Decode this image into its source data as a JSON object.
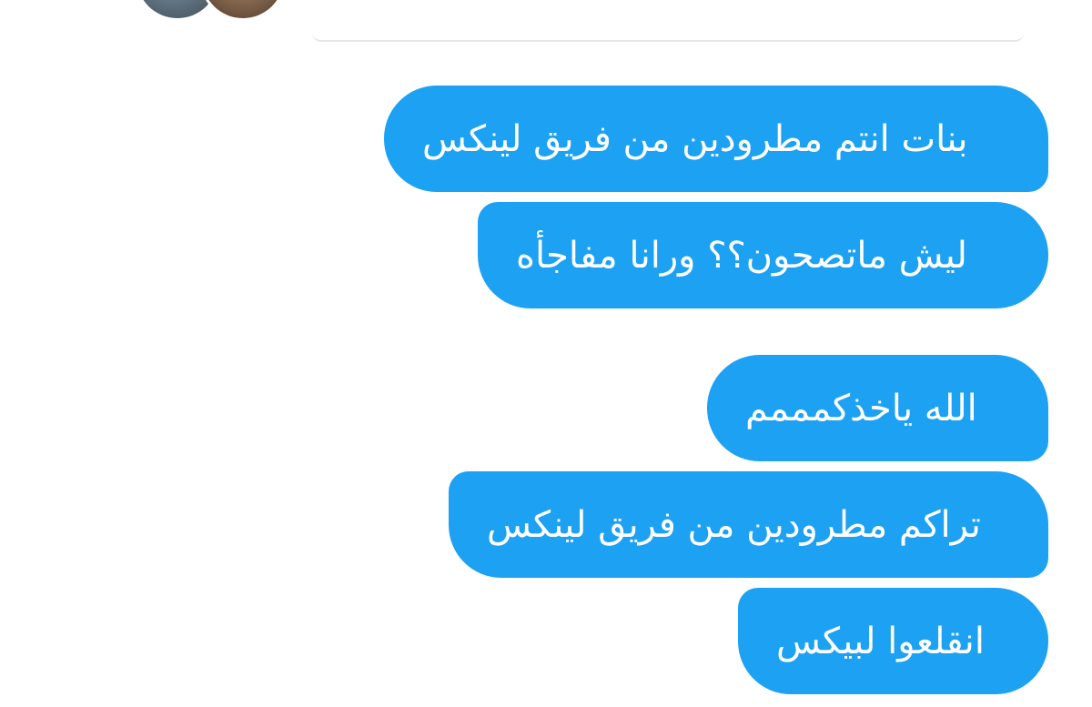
{
  "conversation": {
    "messages": [
      {
        "text": "بنات انتم مطرودين من فريق لينكس"
      },
      {
        "text": "ليش ماتصحون؟؟ ورانا مفاجأه"
      },
      {
        "text": "الله ياخذكمممم"
      },
      {
        "text": "تراكم مطرودين من فريق لينكس"
      },
      {
        "text": "انقلعوا لبيكس"
      }
    ],
    "bubble_color": "#1da1f2"
  },
  "header": {
    "avatars": [
      {
        "icon": "participant-avatar"
      },
      {
        "icon": "participant-avatar"
      }
    ]
  }
}
